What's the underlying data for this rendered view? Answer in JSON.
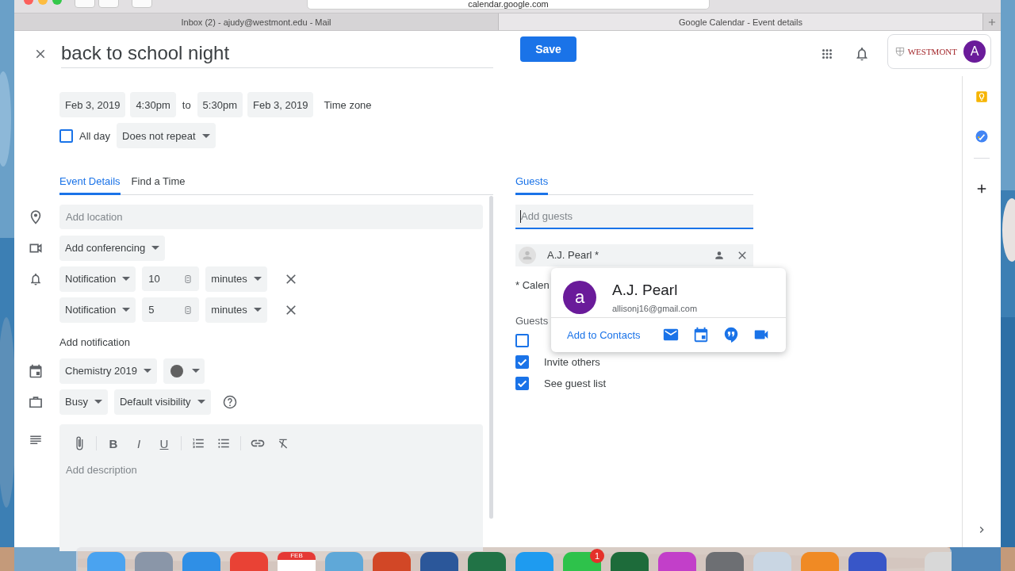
{
  "browser": {
    "address": "calendar.google.com",
    "tabs": [
      {
        "label": "Inbox (2) - ajudy@westmont.edu - Mail",
        "selected": false
      },
      {
        "label": "Google Calendar - Event details",
        "selected": true
      }
    ]
  },
  "header": {
    "title": "back to school night",
    "save": "Save",
    "org": "WESTMONT",
    "avatar": "A"
  },
  "when": {
    "start_date": "Feb 3, 2019",
    "start_time": "4:30pm",
    "to": "to",
    "end_time": "5:30pm",
    "end_date": "Feb 3, 2019",
    "time_zone": "Time zone",
    "all_day": {
      "label": "All day",
      "checked": false
    },
    "repeat": "Does not repeat"
  },
  "tabs": [
    {
      "label": "Event Details",
      "selected": true
    },
    {
      "label": "Find a Time",
      "selected": false
    }
  ],
  "details": {
    "location_placeholder": "Add location",
    "conferencing": "Add conferencing",
    "notifications": [
      {
        "type": "Notification",
        "value": "10",
        "unit": "minutes"
      },
      {
        "type": "Notification",
        "value": "5",
        "unit": "minutes"
      }
    ],
    "add_notification": "Add notification",
    "calendar": "Chemistry 2019",
    "availability": "Busy",
    "visibility": "Default visibility",
    "format_buttons": [
      "B",
      "I",
      "U"
    ],
    "description_placeholder": "Add description"
  },
  "guests": {
    "tab": {
      "label": "Guests",
      "selected": true
    },
    "placeholder": "Add guests",
    "guest": "A.J. Pearl *",
    "calendar_note": "* Calen",
    "permissions_heading": "Guests",
    "permissions": [
      {
        "checked": false
      },
      {
        "label": "Invite others",
        "checked": true
      },
      {
        "label": "See guest list",
        "checked": true
      }
    ]
  },
  "popup": {
    "avatar": "a",
    "name": "A.J. Pearl",
    "email": "allisonj16@gmail.com",
    "action": "Add to Contacts"
  },
  "dock": {
    "apps": [
      {
        "color": "#4aa3f0"
      },
      {
        "color": "#8a96a8"
      },
      {
        "color": "#2f8fe6"
      },
      {
        "color": "#e94235"
      },
      {
        "color": "#ffffff",
        "label": "FEB"
      },
      {
        "color": "#5fa8d8"
      },
      {
        "color": "#d24726"
      },
      {
        "color": "#2b579a"
      },
      {
        "color": "#217346"
      },
      {
        "color": "#1e9bf0"
      },
      {
        "color": "#2ec24b",
        "badge": "1"
      },
      {
        "color": "#1d6b3a"
      },
      {
        "color": "#c23fc9"
      },
      {
        "color": "#6d6f73"
      },
      {
        "color": "#c9d6e3"
      },
      {
        "color": "#f08a24"
      },
      {
        "color": "#3856c8"
      },
      {
        "color": "#d8d8d8"
      }
    ]
  }
}
